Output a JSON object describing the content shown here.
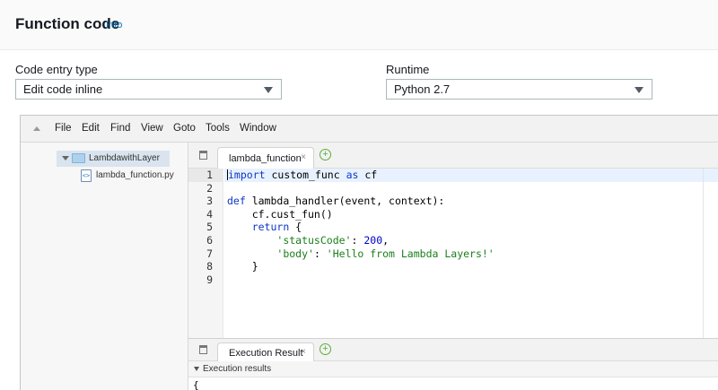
{
  "header": {
    "title": "Function code",
    "info": "Info"
  },
  "code_entry": {
    "label": "Code entry type",
    "value": "Edit code inline"
  },
  "runtime": {
    "label": "Runtime",
    "value": "Python 2.7"
  },
  "ide": {
    "menu": [
      "File",
      "Edit",
      "Find",
      "View",
      "Goto",
      "Tools",
      "Window"
    ],
    "tree": {
      "folder": "LambdawithLayer",
      "file": "lambda_function.py"
    },
    "editor_tab": {
      "label": "lambda_function",
      "close": "×",
      "add": "+"
    },
    "line_numbers": [
      "1",
      "2",
      "3",
      "4",
      "5",
      "6",
      "7",
      "8",
      "9"
    ],
    "code": {
      "l1_import": "import",
      "l1_module": " custom_func ",
      "l1_as": "as",
      "l1_alias": " cf",
      "l3_def": "def",
      "l3_rest": " lambda_handler(event, context):",
      "l4": "    cf.cust_fun()",
      "l5_indent": "    ",
      "l5_return": "return",
      "l5_brace": " {",
      "l6_indent": "        ",
      "l6_key": "'statusCode'",
      "l6_colon": ": ",
      "l6_val": "200",
      "l6_comma": ",",
      "l7_indent": "        ",
      "l7_key": "'body'",
      "l7_colon": ": ",
      "l7_val": "'Hello from Lambda Layers!'",
      "l8": "    }"
    },
    "result_tab": {
      "label": "Execution Result",
      "close": "×",
      "add": "+"
    },
    "result_header": "Execution results",
    "result_body": "{"
  }
}
